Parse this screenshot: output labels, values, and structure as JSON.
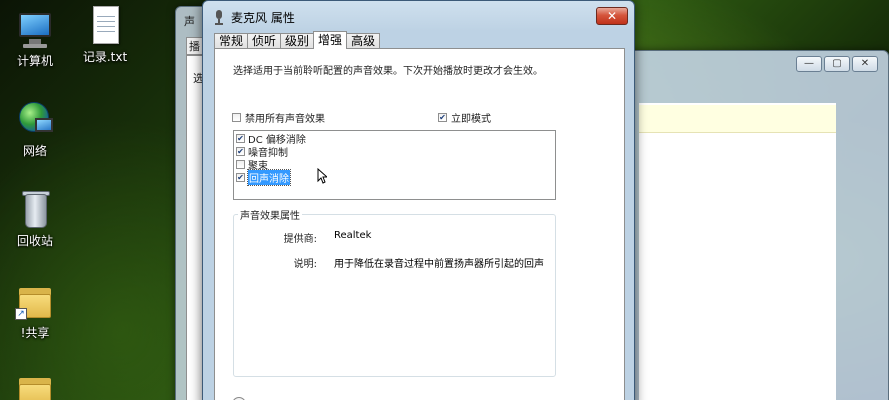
{
  "desktop": {
    "icons": [
      {
        "label": "计算机"
      },
      {
        "label": "记录.txt"
      },
      {
        "label": "网络"
      },
      {
        "label": "回收站"
      },
      {
        "label": "!共享"
      }
    ]
  },
  "background_windows": {
    "sound": {
      "title": "声",
      "tab": "播",
      "text": "选"
    },
    "explorer": {
      "min": "—",
      "max": "▢",
      "close": "✕"
    }
  },
  "dialog": {
    "title": "麦克风 属性",
    "close_label": "✕",
    "tabs": [
      "常规",
      "侦听",
      "级别",
      "增强",
      "高级"
    ],
    "active_tab": "增强",
    "instruction": "选择适用于当前聆听配置的声音效果。下次开始播放时更改才会生效。",
    "disable_all": {
      "label": "禁用所有声音效果",
      "checked": false
    },
    "immediate_mode": {
      "label": "立即模式",
      "checked": true
    },
    "effects": [
      {
        "label": "DC 偏移消除",
        "checked": true
      },
      {
        "label": "噪音抑制",
        "checked": true
      },
      {
        "label": "聚束",
        "checked": false
      },
      {
        "label": "回声消除",
        "checked": true,
        "selected": true
      }
    ],
    "properties": {
      "group_title": "声音效果属性",
      "provider_label": "提供商:",
      "provider_value": "Realtek",
      "description_label": "说明:",
      "description_value": "用于降低在录音过程中前置扬声器所引起的回声"
    }
  },
  "colors": {
    "selection": "#3399ff",
    "close_button": "#c0321a",
    "info_bar": "#ffffe1"
  }
}
